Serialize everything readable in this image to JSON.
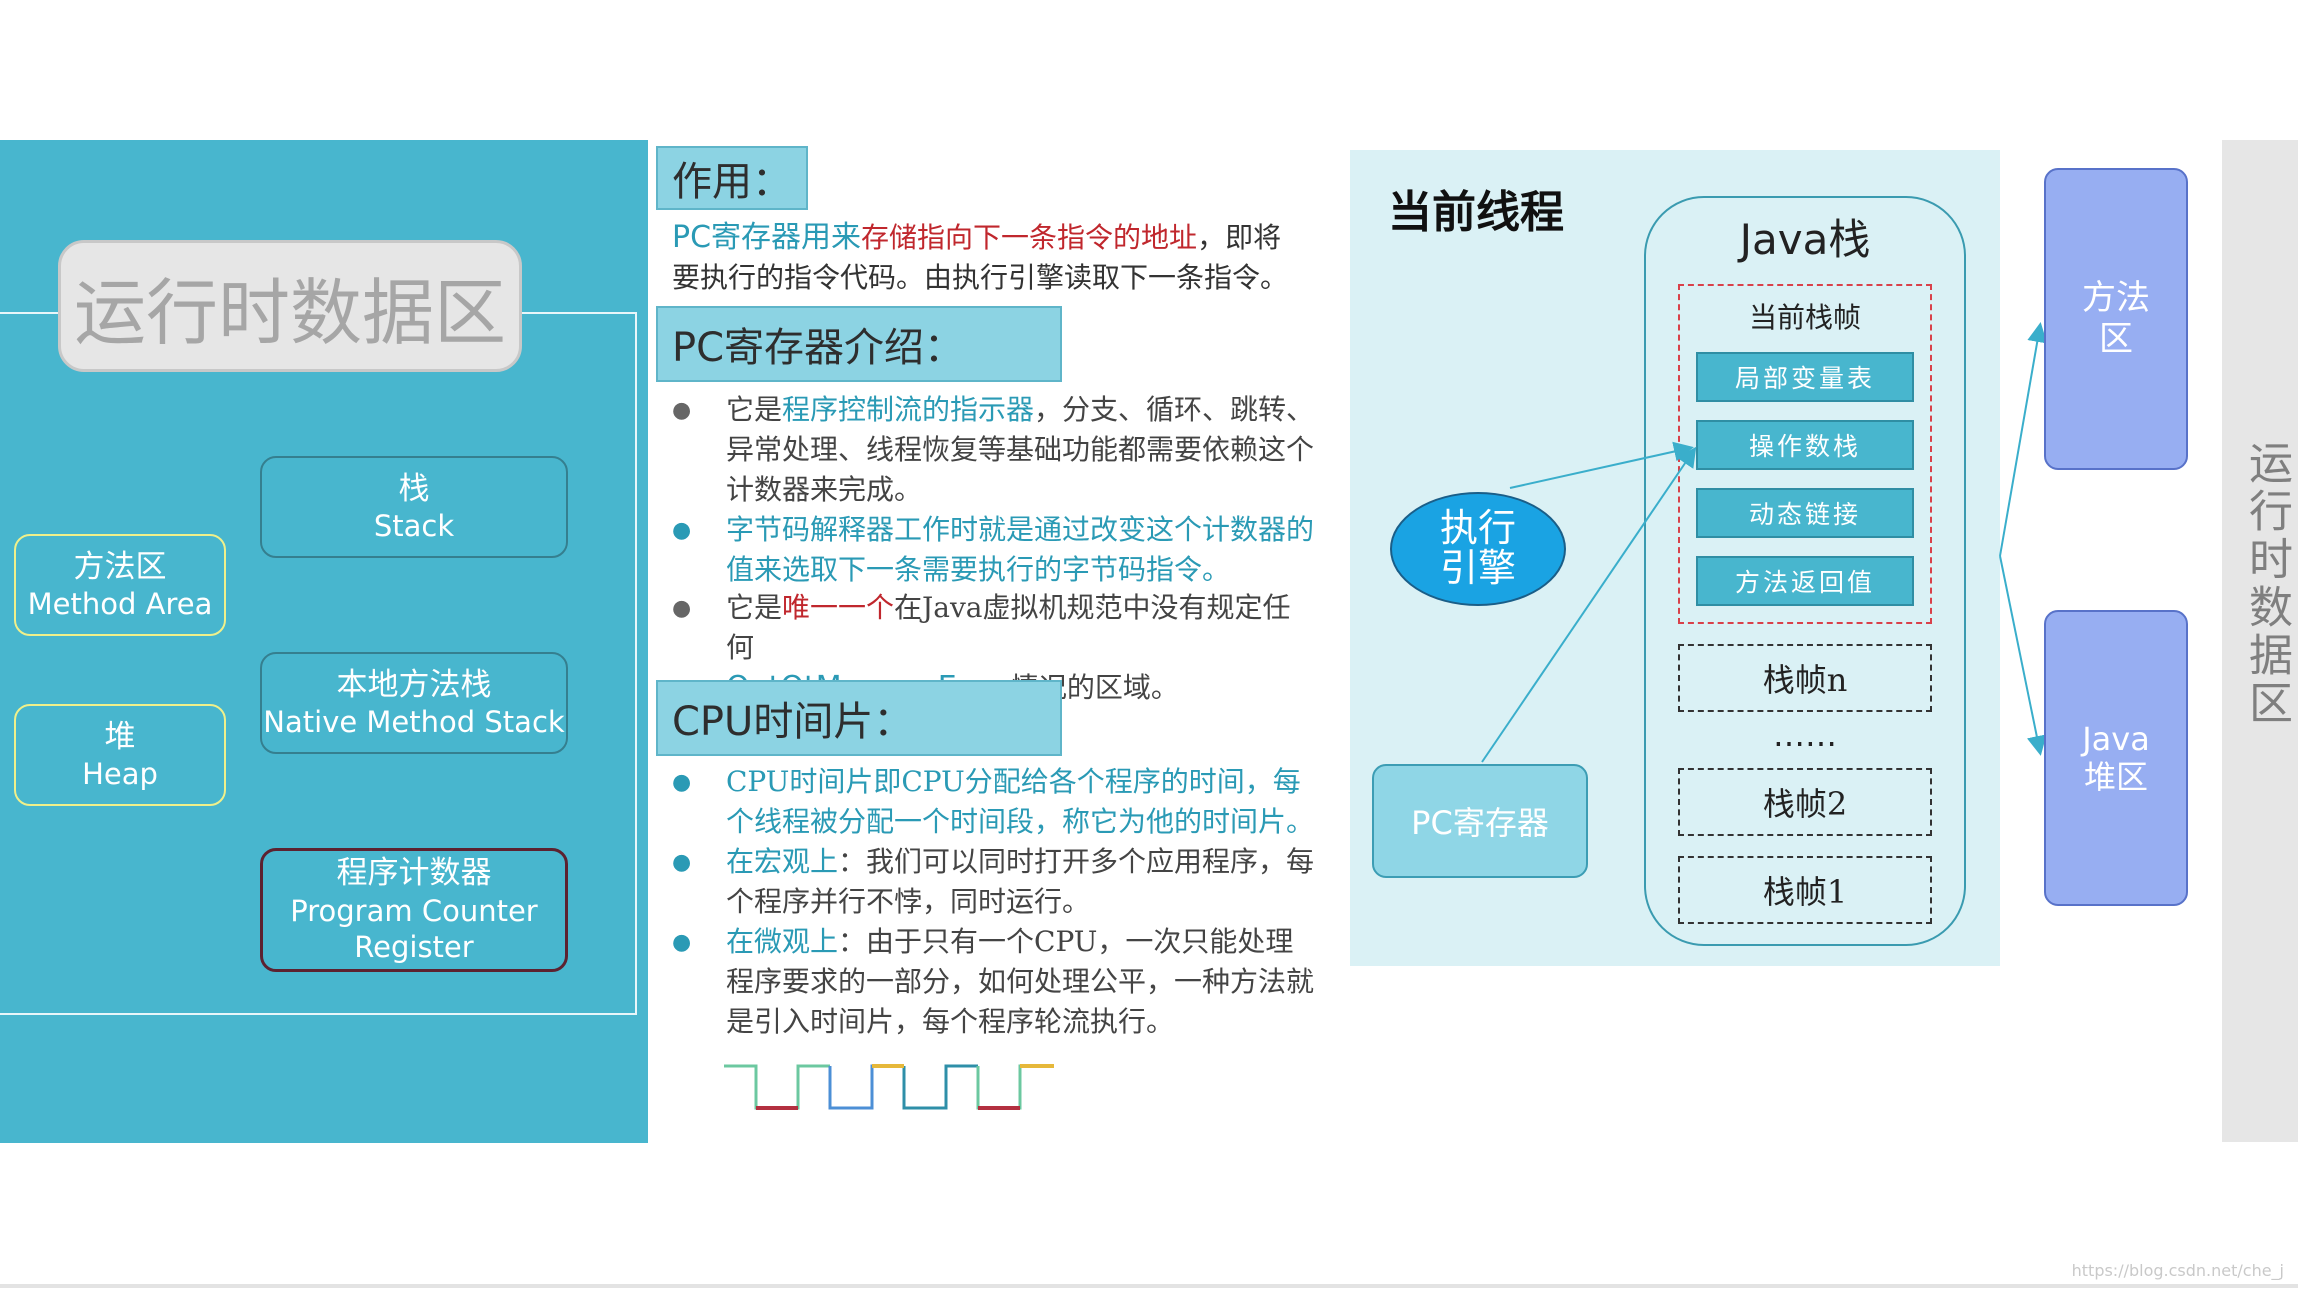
{
  "left": {
    "title": "运行时数据区",
    "stack": {
      "cn": "栈",
      "en": "Stack"
    },
    "native": {
      "cn": "本地方法栈",
      "en": "Native Method Stack"
    },
    "pc": {
      "cn": "程序计数器",
      "en1": "Program Counter",
      "en2": "Register"
    },
    "method": {
      "cn": "方法区",
      "en": "Method Area"
    },
    "heap": {
      "cn": "堆",
      "en": "Heap"
    }
  },
  "middle": {
    "role_head": "作用：",
    "role_p1": "PC寄存器用来",
    "role_p2": "存储指向下一条指令的地址",
    "role_p3": "，即将要执行的指令代码。由执行引擎读取下一条指令。",
    "pc_head": "PC寄存器介绍：",
    "pc_b1_a": "它是",
    "pc_b1_b": "程序控制流的指示器",
    "pc_b1_c": "，分支、循环、跳转、异常处理、线程恢复等基础功能都需要依赖这个计数器来完成。",
    "pc_b2": "字节码解释器工作时就是通过改变这个计数器的值来选取下一条需要执行的字节码指令。",
    "pc_b3_a": "它是",
    "pc_b3_b": "唯一一个",
    "pc_b3_c": "在Java虚拟机规范中没有规定任何",
    "pc_b3_d": "OutOtMemoryError",
    "pc_b3_e": "情况的区域。",
    "cpu_head": "CPU时间片：",
    "cpu_b1": "CPU时间片即CPU分配给各个程序的时间，每个线程被分配一个时间段，称它为他的时间片。",
    "cpu_b2_a": "在宏观上",
    "cpu_b2_b": "：我们可以同时打开多个应用程序，每个程序并行不悖，同时运行。",
    "cpu_b3_a": "在微观上",
    "cpu_b3_b": "：由于只有一个CPU，一次只能处理程序要求的一部分，如何处理公平，一种方法就是引入时间片，每个程序轮流执行。"
  },
  "right": {
    "thread_title": "当前线程",
    "java_stack": "Java栈",
    "current_frame": "当前栈帧",
    "slots": [
      "局部变量表",
      "操作数栈",
      "动态链接",
      "方法返回值"
    ],
    "frame_n": "栈帧n",
    "dots": "……",
    "frame_2": "栈帧2",
    "frame_1": "栈帧1",
    "engine_1": "执行",
    "engine_2": "引擎",
    "pc_reg": "PC寄存器",
    "method_1": "方法",
    "method_2": "区",
    "heap_1": "Java",
    "heap_2": "堆区",
    "strip": "运行时数据区"
  },
  "watermark": "https://blog.csdn.net/che_j",
  "colors": {
    "panel": "#48b6ce",
    "header": "#8cd3e3",
    "accent_teal": "#2a9ab5",
    "accent_red": "#c0272d",
    "engine": "#1aa3e3",
    "area_blue": "#97aef2"
  }
}
